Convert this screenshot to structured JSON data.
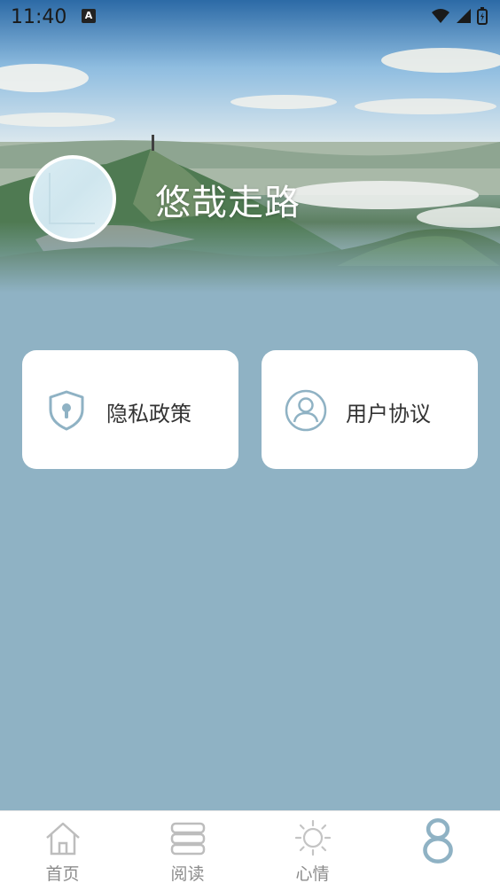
{
  "status_bar": {
    "time": "11:40",
    "notification_letter": "A"
  },
  "profile": {
    "username": "悠哉走路"
  },
  "cards": [
    {
      "label": "隐私政策",
      "icon": "shield-lock-icon"
    },
    {
      "label": "用户协议",
      "icon": "user-profile-icon"
    }
  ],
  "tabbar": {
    "tabs": [
      {
        "label": "首页",
        "icon": "home-icon"
      },
      {
        "label": "阅读",
        "icon": "book-icon"
      },
      {
        "label": "心情",
        "icon": "sun-icon"
      },
      {
        "label": "",
        "icon": "profile-eight-icon"
      }
    ]
  },
  "colors": {
    "page_bg": "#8fb2c4",
    "accent": "#8fb2c4",
    "card_bg": "#ffffff",
    "tab_inactive": "#8c8c8c"
  }
}
